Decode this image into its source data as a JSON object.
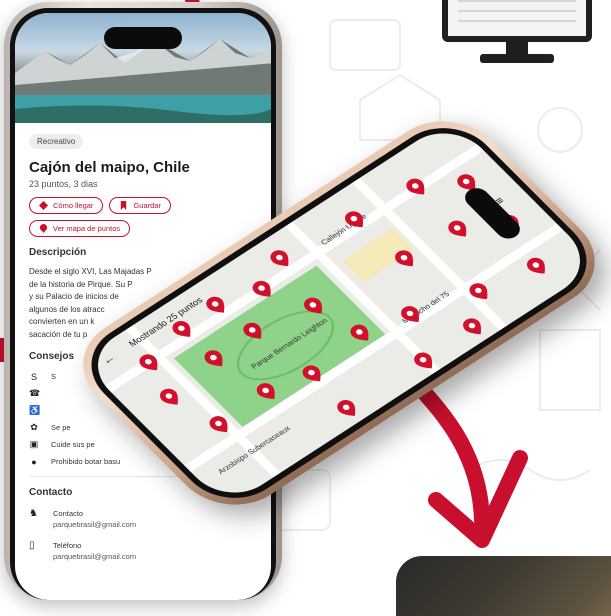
{
  "profile_screen": {
    "category_tag": "Recreativo",
    "title": "Cajón del maipo, Chile",
    "subtitle": "23 puntos, 3 dias",
    "buttons": {
      "how_to_arrive": "Cómo llegar",
      "save": "Guardar",
      "view_map": "Ver mapa de puntos"
    },
    "description_heading": "Descripción",
    "description_lines": [
      "Desde el siglo XVI, Las Majadas P",
      "de la historia de Pirque. Su P",
      "y su Palacio de inicios de",
      "algunos de los atracc",
      "convierten en un k",
      "sacación de tu p"
    ],
    "tips_heading": "Consejos",
    "tips": [
      {
        "icon": "letter-s-icon",
        "text": "S"
      },
      {
        "icon": "phone-icon",
        "text": ""
      },
      {
        "icon": "accessibility-icon",
        "text": ""
      },
      {
        "icon": "paw-icon",
        "text": "Se pe"
      },
      {
        "icon": "trash-icon",
        "text": "Cuide sus pe"
      },
      {
        "icon": "no-entry-icon",
        "text": "Prohibido botar basu"
      }
    ],
    "contact_heading": "Contacto",
    "contacts": [
      {
        "icon": "person-icon",
        "label": "Contacto",
        "value": "parquebrasil@gmail.com"
      },
      {
        "icon": "phone-outline-icon",
        "label": "Teléfono",
        "value": "parquebrasil@gmail.com"
      }
    ]
  },
  "map_screen": {
    "header": "Mostrando 25 puntos",
    "back_icon": "back-arrow-icon",
    "filter_icon": "filter-icon",
    "street_labels": [
      "Parque Bernardo Leighton",
      "Callejón Ugarte",
      "Mapocho del 75",
      "Arzobispo Subercaseaux"
    ],
    "pin_color": "#d3102c",
    "park_color": "#8fd28a"
  },
  "colors": {
    "accent": "#c4122d",
    "arrow": "#c8102e"
  }
}
